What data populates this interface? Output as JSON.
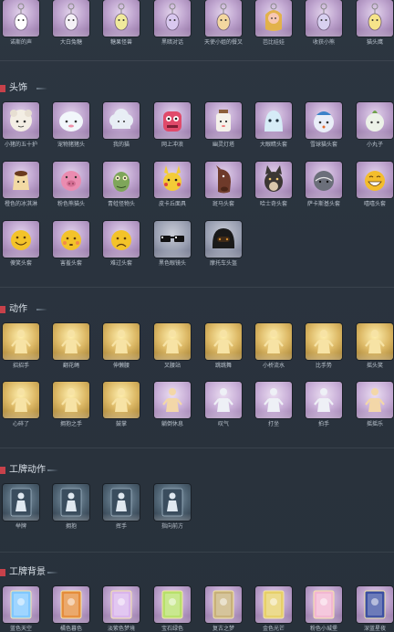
{
  "sections": [
    {
      "id": "top",
      "title": "",
      "rows": [
        [
          "诺斯的声",
          "大白兔糖",
          "糖果怪兽",
          "黑暗对话",
          "天使小姐的餐叉",
          "芭比娃娃",
          "收获小熊",
          "猫头鹰"
        ]
      ]
    },
    {
      "id": "headwear",
      "title": "头饰",
      "rows": [
        [
          "小猪的五十护",
          "宠物猪猪头",
          "我的猫",
          "网上冲浪",
          "幽灵灯塔",
          "大眼睛头套",
          "雪球猫头套",
          "小丸子"
        ],
        [
          "橙色的冰淇淋",
          "粉色熊猫头",
          "青蛙怪物头",
          "皮卡丘面具",
          "斑马头套",
          "哈士奇头套",
          "萨卡斯基头套",
          "嘻嘻头套"
        ],
        [
          "傻笑头套",
          "害羞头套",
          "难过头套",
          "黑色眼镜头",
          "摩托车头盔"
        ]
      ]
    },
    {
      "id": "emotes",
      "title": "动作",
      "rows": [
        [
          "招招手",
          "翻花绳",
          "伸懒腰",
          "叉腰站",
          "跳跳舞",
          "小桥流水",
          "比手势",
          "摇头笑"
        ],
        [
          "心碎了",
          "拥抱之手",
          "鼓掌",
          "躺倒休息",
          "叹气",
          "打坐",
          "拍手",
          "摇摇乐"
        ]
      ]
    },
    {
      "id": "badge-emotes",
      "title": "工牌动作",
      "rows": [
        [
          "举牌",
          "拥抱",
          "挥手",
          "指向前方"
        ]
      ]
    },
    {
      "id": "badge-bg",
      "title": "工牌背景",
      "rows": [
        [
          "蓝色天空",
          "橘色暮色",
          "淡紫色梦境",
          "宝石绿色",
          "复古之梦",
          "金色光芒",
          "粉色小城堡",
          "深蓝星夜"
        ]
      ]
    }
  ],
  "cards": {
    "top": [
      {
        "style": "purple",
        "icon": "keychain-icon",
        "color": "#ffffff"
      },
      {
        "style": "purple",
        "icon": "keychain-icon",
        "color": "#f4f0f6"
      },
      {
        "style": "purple",
        "icon": "keychain-icon",
        "color": "#f0ea9c"
      },
      {
        "style": "purple",
        "icon": "keychain-icon",
        "color": "#d9c8ef"
      },
      {
        "style": "purple",
        "icon": "keychain-icon",
        "color": "#f3d7a0"
      },
      {
        "style": "purple",
        "icon": "doll-keychain-icon",
        "color": "#f7c7b3"
      },
      {
        "style": "purple",
        "icon": "keychain-icon",
        "color": "#d8d0f0"
      },
      {
        "style": "purple",
        "icon": "keychain-icon",
        "color": "#f6e48a"
      }
    ],
    "headwear": [
      [
        {
          "style": "purple",
          "icon": "sheep-head-icon",
          "color": "#f3eee4"
        },
        {
          "style": "purple",
          "icon": "white-head-icon",
          "color": "#f2f7fb"
        },
        {
          "style": "purple",
          "icon": "cloud-head-icon",
          "color": "#e8eef5"
        },
        {
          "style": "purple",
          "icon": "pink-monster-head-icon",
          "color": "#e04a6a"
        },
        {
          "style": "purple",
          "icon": "lantern-head-icon",
          "color": "#f4f1ea"
        },
        {
          "style": "purple",
          "icon": "ghost-head-icon",
          "color": "#d6ecf7"
        },
        {
          "style": "purple",
          "icon": "snowball-head-icon",
          "color": "#e9eef8"
        },
        {
          "style": "purple",
          "icon": "bulb-head-icon",
          "color": "#ecf2e8"
        }
      ],
      [
        {
          "style": "purple",
          "icon": "pudding-head-icon",
          "color": "#f2d9a4"
        },
        {
          "style": "purple",
          "icon": "pig-head-icon",
          "color": "#ea8cb0"
        },
        {
          "style": "purple",
          "icon": "frog-head-icon",
          "color": "#7ea65a"
        },
        {
          "style": "purple",
          "icon": "pikachu-head-icon",
          "color": "#f3cc37"
        },
        {
          "style": "purple",
          "icon": "horse-head-icon",
          "color": "#6e3a2a"
        },
        {
          "style": "purple",
          "icon": "husky-head-icon",
          "color": "#3b3734"
        },
        {
          "style": "purple",
          "icon": "seal-head-icon",
          "color": "#6b6f7a"
        },
        {
          "style": "purple",
          "icon": "grin-head-icon",
          "color": "#f3bd2c"
        }
      ],
      [
        {
          "style": "purple",
          "icon": "smile-head-icon",
          "color": "#f3c32a"
        },
        {
          "style": "purple",
          "icon": "blush-head-icon",
          "color": "#f3c32a"
        },
        {
          "style": "purple",
          "icon": "sad-head-icon",
          "color": "#f3c32a"
        },
        {
          "style": "steel",
          "icon": "sunglasses-icon",
          "color": "#111111"
        },
        {
          "style": "steel",
          "icon": "helmet-icon",
          "color": "#1a1a1a"
        }
      ]
    ],
    "emotes": [
      [
        {
          "style": "gold",
          "icon": "figure-icon",
          "color": "#f7e3a5"
        },
        {
          "style": "gold",
          "icon": "figure-icon",
          "color": "#f7e3a5"
        },
        {
          "style": "gold",
          "icon": "figure-icon",
          "color": "#f7e3a5"
        },
        {
          "style": "gold",
          "icon": "figure-icon",
          "color": "#f7e3a5"
        },
        {
          "style": "gold",
          "icon": "figure-icon",
          "color": "#f7e3a5"
        },
        {
          "style": "gold",
          "icon": "figure-icon",
          "color": "#f7e3a5"
        },
        {
          "style": "gold",
          "icon": "figure-icon",
          "color": "#f7e3a5"
        },
        {
          "style": "gold",
          "icon": "figure-icon",
          "color": "#f7e3a5"
        }
      ],
      [
        {
          "style": "gold",
          "icon": "figure-icon",
          "color": "#f7e3a5"
        },
        {
          "style": "gold",
          "icon": "figure-icon",
          "color": "#f7e3a5"
        },
        {
          "style": "gold",
          "icon": "figure-icon",
          "color": "#f7e3a5"
        },
        {
          "style": "lilac",
          "icon": "figure-icon",
          "color": "#f3d7a8"
        },
        {
          "style": "lilac",
          "icon": "figure-icon",
          "color": "#eef0f6"
        },
        {
          "style": "lilac",
          "icon": "figure-icon",
          "color": "#eef0f6"
        },
        {
          "style": "lilac",
          "icon": "figure-icon",
          "color": "#eef0f6"
        },
        {
          "style": "lilac",
          "icon": "figure-icon",
          "color": "#f3d7a8"
        }
      ]
    ],
    "badge-emotes": [
      {
        "style": "dark",
        "icon": "badge-figure-icon",
        "color": "#dfe8f0"
      },
      {
        "style": "dark",
        "icon": "badge-figure-icon",
        "color": "#dfe8f0"
      },
      {
        "style": "dark",
        "icon": "badge-figure-icon",
        "color": "#dfe8f0"
      },
      {
        "style": "dark",
        "icon": "badge-figure-icon",
        "color": "#dfe8f0"
      }
    ],
    "badge-bg": [
      {
        "style": "purple",
        "icon": "badge-card-icon",
        "color": "#7fc7ff"
      },
      {
        "style": "purple",
        "icon": "badge-card-icon",
        "color": "#e58c3b"
      },
      {
        "style": "purple",
        "icon": "badge-card-icon",
        "color": "#d9b4ec"
      },
      {
        "style": "purple",
        "icon": "badge-card-icon",
        "color": "#b7e06a"
      },
      {
        "style": "purple",
        "icon": "badge-card-icon",
        "color": "#c7b07a"
      },
      {
        "style": "purple",
        "icon": "badge-card-icon",
        "color": "#e6cf69"
      },
      {
        "style": "purple",
        "icon": "badge-card-icon",
        "color": "#f2b6d2"
      },
      {
        "style": "purple",
        "icon": "badge-card-icon",
        "color": "#3b4fa2"
      }
    ]
  }
}
